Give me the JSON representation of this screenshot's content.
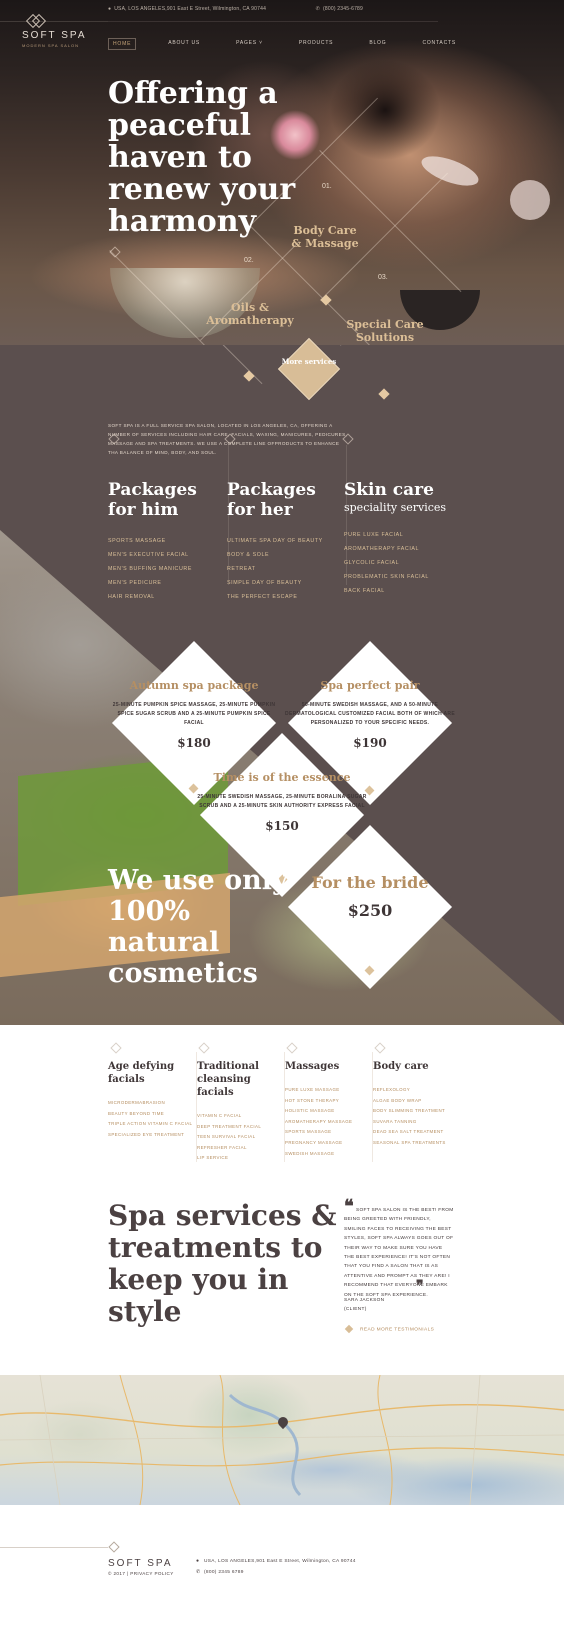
{
  "topbar": {
    "address": "USA, LOS ANGELES,901 East E Street, Wilmington, CA 90744",
    "phone": "(800) 2345-6789"
  },
  "brand": {
    "name": "SOFT SPA",
    "tagline": "MODERN SPA SALON"
  },
  "nav": {
    "items": [
      "HOME",
      "ABOUT US",
      "PAGES",
      "PRODUCTS",
      "BLOG",
      "CONTACTS"
    ],
    "active_index": 0
  },
  "hero": {
    "title": "Offering a peaceful haven to renew your harmony",
    "services": [
      {
        "num": "01.",
        "label": "Body Care & Massage"
      },
      {
        "num": "02.",
        "label": "Oils & Aromatherapy"
      },
      {
        "num": "03.",
        "label": "Special Care Solutions"
      }
    ],
    "more_label": "More services"
  },
  "intro": {
    "text": "SOFT SPA IS A FULL SERVICE SPA SALON, LOCATED IN LOS ANGELES, CA, OFFERING A NUMBER OF SERVICES INCLUDING HAIR CARE, FACIALS, WAXING, MANICURES, PEDICURES, MASSAGE AND SPA TREATMENTS. WE USE A COMPLETE LINE OFPRODUCTS TO ENHANCE THA BALANCE OF MIND, BODY, AND SOUL."
  },
  "packages": [
    {
      "title": "Packages for him",
      "subtitle": "",
      "items": [
        "SPORTS MASSAGE",
        "MEN'S EXECUTIVE FACIAL",
        "MEN'S BUFFING MANICURE",
        "MEN'S PEDICURE",
        "HAIR REMOVAL"
      ]
    },
    {
      "title": "Packages for her",
      "subtitle": "",
      "items": [
        "ULTIMATE SPA DAY OF BEAUTY",
        "BODY & SOLE",
        "RETREAT",
        "SIMPLE DAY OF BEAUTY",
        "THE PERFECT ESCAPE"
      ]
    },
    {
      "title": "Skin care",
      "subtitle": "speciality services",
      "items": [
        "PURE LUXE FACIAL",
        "AROMATHERAPY FACIAL",
        "GLYCOLIC FACIAL",
        "PROBLEMATIC SKIN FACIAL",
        "BACK FACIAL"
      ]
    }
  ],
  "offers": [
    {
      "title": "Autumn spa package",
      "desc": "25-MINUTE PUMPKIN SPICE MASSAGE, 25-MINUTE PUMPKIN SPICE SUGAR SCRUB AND A 25-MINUTE PUMPKIN SPICE FACIAL",
      "price": "$180"
    },
    {
      "title": "Spa perfect pair",
      "desc": "50-MINUTE SWEDISH MASSAGE, AND A 50-MINUTE DERMATOLOGICAL CUSTOMIZED FACIAL BOTH OF WHICH ARE PERSONALIZED TO YOUR SPECIFIC NEEDS.",
      "price": "$190"
    },
    {
      "title": "Time is of the essence",
      "desc": "25-MINUTE SWEDISH MASSAGE, 25-MINUTE BORALINA SUGAR SCRUB AND A 25-MINUTE SKIN AUTHORITY EXPRESS FACIAL",
      "price": "$150"
    },
    {
      "title": "For the bride",
      "desc": "",
      "price": "$250"
    }
  ],
  "natural": {
    "text": "We use only 100% natural cosmetics"
  },
  "services": [
    {
      "title": "Age defying facials",
      "items": [
        "MICRODERMABRASION",
        "BEAUTY BEYOND TIME",
        "TRIPLE ACTION VITAMIN C FACIAL",
        "SPECIALIZED EYE TREATMENT"
      ]
    },
    {
      "title": "Traditional cleansing facials",
      "items": [
        "VITAMIN C FACIAL",
        "DEEP TREATMENT FACIAL",
        "TEEN SURVIVAL FACIAL",
        "REFRESHER FACIAL",
        "LIP SERVICE"
      ]
    },
    {
      "title": "Massages",
      "items": [
        "PURE LUXE MASSAGE",
        "HOT STONE THERAPY",
        "HOLISTIC MASSAGE",
        "AROMATHERAPY MASSAGE",
        "SPORTS MASSAGE",
        "PREGNANCY MASSAGE",
        "SWEDISH MASSAGE"
      ]
    },
    {
      "title": "Body care",
      "items": [
        "REFLEXOLOGY",
        "ALGAE BODY WRAP",
        "BODY SLIMMING TREATMENT",
        "SUVARA TANNING",
        "DEAD SEA SALT TREATMENT",
        "SEASONAL SPA TREATMENTS"
      ]
    }
  ],
  "testimonial": {
    "heading": "Spa services & treatments to keep you in style",
    "quote": "SOFT SPA SALON IS THE BEST! FROM BEING GREETED WITH FRIENDLY, SMILING FACES TO RECEIVING THE BEST STYLES, SOFT SPA ALWAYS GOES OUT OF THEIR WAY TO MAKE SURE YOU HAVE THE BEST EXPERIENCE! IT'S NOT OFTEN THAT YOU FIND A SALON THAT IS AS ATTENTIVE AND PROMPT AS THEY ARE! I RECOMMEND THAT EVERYONE EMBARK ON THE SOFT SPA EXPERIENCE.",
    "author": "SARA JACKSON",
    "role": "(CLIENT)",
    "link": "READ MORE TESTIMONIALS"
  },
  "footer": {
    "logo": "SOFT SPA",
    "copyright": "© 2017 | PRIVACY POLICY",
    "address": "USA, LOS ANGELES,901 East E Street, Wilmington, CA 90744",
    "phone": "(800) 2345 6789"
  }
}
